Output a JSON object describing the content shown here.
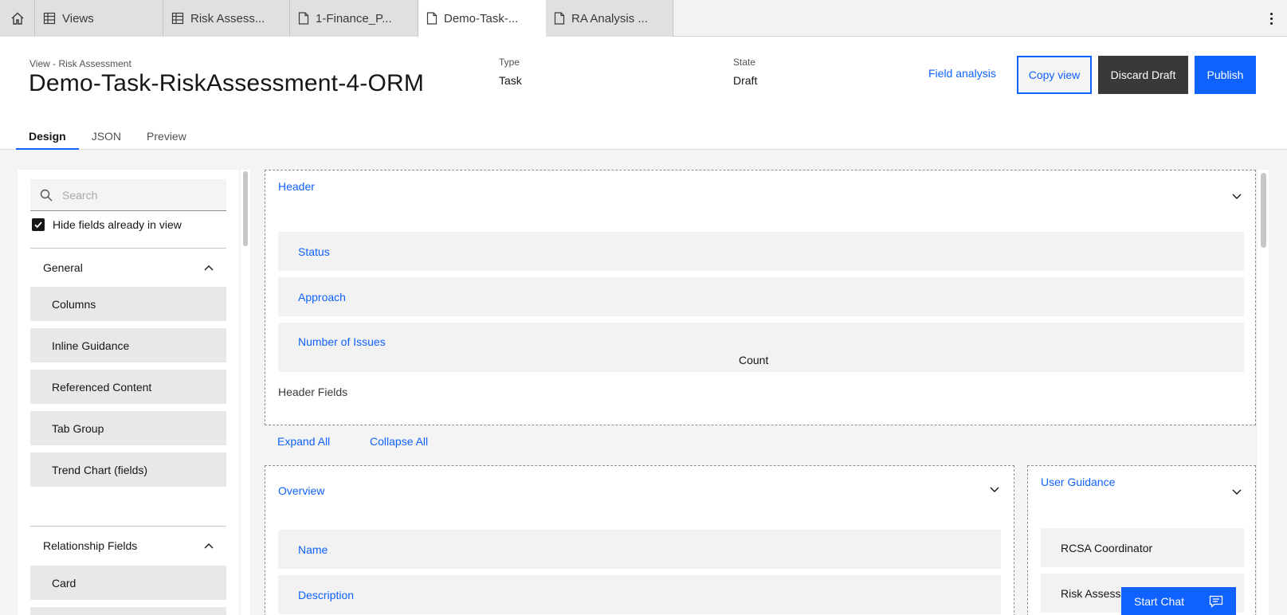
{
  "tabs": [
    {
      "label": "Views",
      "icon": "table-icon"
    },
    {
      "label": "Risk Assess...",
      "icon": "table-icon"
    },
    {
      "label": "1-Finance_P...",
      "icon": "document-icon"
    },
    {
      "label": "Demo-Task-...",
      "icon": "document-icon"
    },
    {
      "label": "RA Analysis ...",
      "icon": "document-icon"
    }
  ],
  "header": {
    "eyebrow": "View - Risk Assessment",
    "title": "Demo-Task-RiskAssessment-4-ORM",
    "type_label": "Type",
    "type_value": "Task",
    "state_label": "State",
    "state_value": "Draft",
    "field_analysis": "Field analysis",
    "copy_view": "Copy view",
    "discard_draft": "Discard Draft",
    "publish": "Publish"
  },
  "content_tabs": [
    "Design",
    "JSON",
    "Preview"
  ],
  "sidebar": {
    "search_placeholder": "Search",
    "hide_fields_label": "Hide fields already in view",
    "hide_fields_checked": true,
    "general_title": "General",
    "general_items": [
      "Columns",
      "Inline Guidance",
      "Referenced Content",
      "Tab Group",
      "Trend Chart (fields)"
    ],
    "relationship_title": "Relationship Fields",
    "relationship_items": [
      "Card"
    ]
  },
  "canvas": {
    "header_section": {
      "title": "Header",
      "fields": [
        "Status",
        "Approach",
        "Number of Issues"
      ],
      "count_label": "Count",
      "footer": "Header Fields"
    },
    "expand_all": "Expand All",
    "collapse_all": "Collapse All",
    "overview_section": {
      "title": "Overview",
      "fields": [
        "Name",
        "Description"
      ]
    },
    "user_guidance_section": {
      "title": "User Guidance",
      "fields": [
        "RCSA Coordinator",
        "Risk Assessment"
      ]
    }
  },
  "chat": {
    "label": "Start Chat"
  },
  "colors": {
    "primary": "#0f62fe",
    "dark_button": "#393939",
    "surface": "#f4f4f4"
  }
}
